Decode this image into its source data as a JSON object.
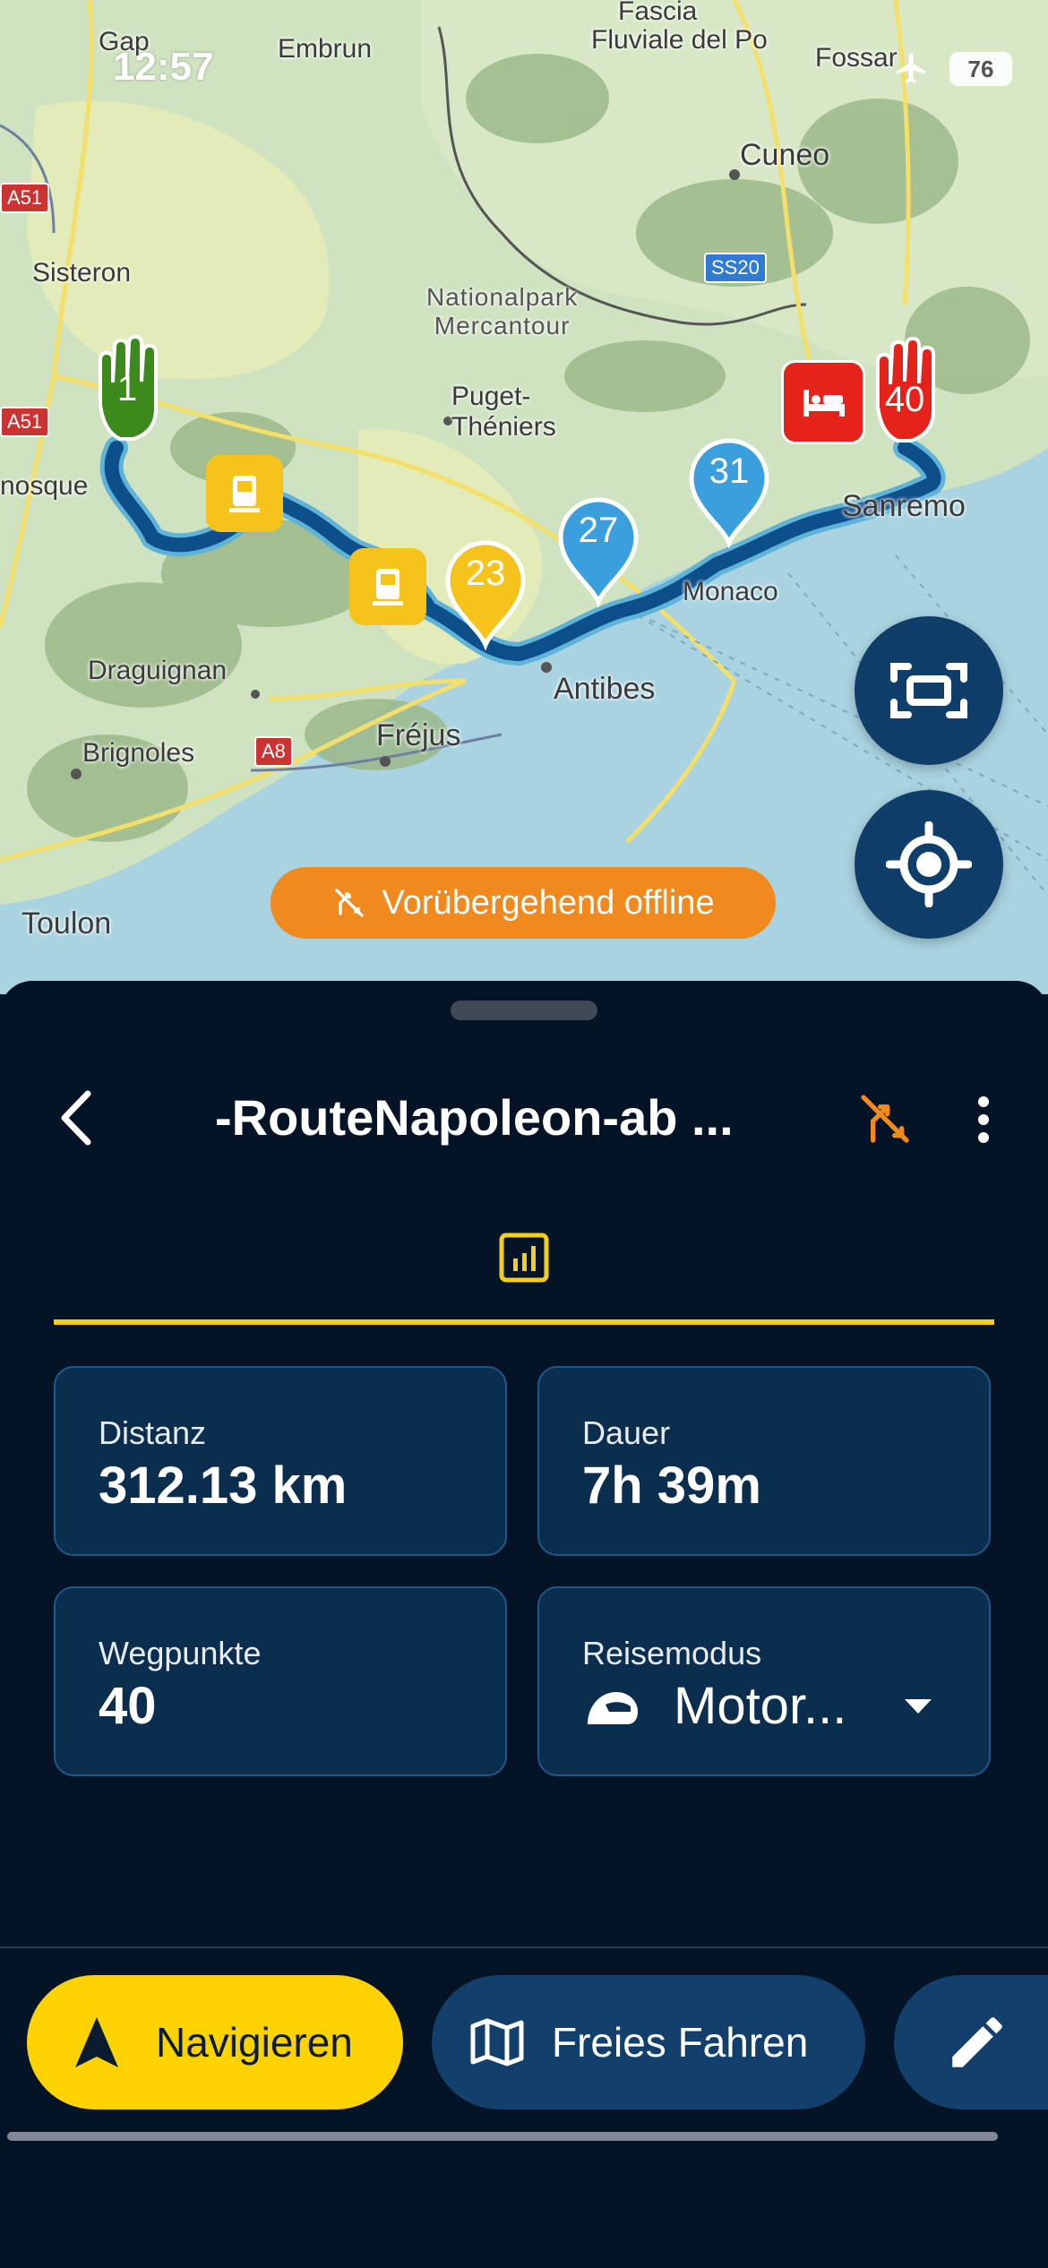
{
  "status_bar": {
    "time": "12:57",
    "battery": "76"
  },
  "map": {
    "labels": {
      "gap": "Gap",
      "embrun": "Embrun",
      "fascia": "Fascia",
      "fluviale": "Fluviale del Po",
      "fossano": "Fossar",
      "cuneo": "Cuneo",
      "sisteron": "Sisteron",
      "park_line1": "Nationalpark",
      "park_line2": "Mercantour",
      "puget_line1": "Puget-",
      "puget_line2": "Théniers",
      "manosque": "nosque",
      "sanremo": "Sanremo",
      "monaco": "Monaco",
      "antibes": "Antibes",
      "draguignan": "Draguignan",
      "brignoles": "Brignoles",
      "frejus": "Fréjus",
      "toulon": "Toulon"
    },
    "shields": {
      "a51_top": "A51",
      "a51_mid": "A51",
      "ss20": "SS20",
      "a8": "A8"
    },
    "waypoints": {
      "start": "1",
      "w23": "23",
      "w27": "27",
      "w31": "31",
      "end": "40"
    },
    "offline_banner": "Vorübergehend offline",
    "colors": {
      "route": "#0d4f8b",
      "start": "#3c8a1c",
      "end": "#e5231b",
      "yellow": "#f6c21c",
      "blue": "#3a9fdc"
    }
  },
  "sheet": {
    "title": "-RouteNapoleon-ab ...",
    "stats": [
      {
        "label": "Distanz",
        "value": "312.13 km"
      },
      {
        "label": "Dauer",
        "value": "7h 39m"
      },
      {
        "label": "Wegpunkte",
        "value": "40"
      },
      {
        "label": "Reisemodus",
        "value": "Motor..."
      }
    ],
    "buttons": {
      "navigate": "Navigieren",
      "free_ride": "Freies Fahren"
    }
  }
}
